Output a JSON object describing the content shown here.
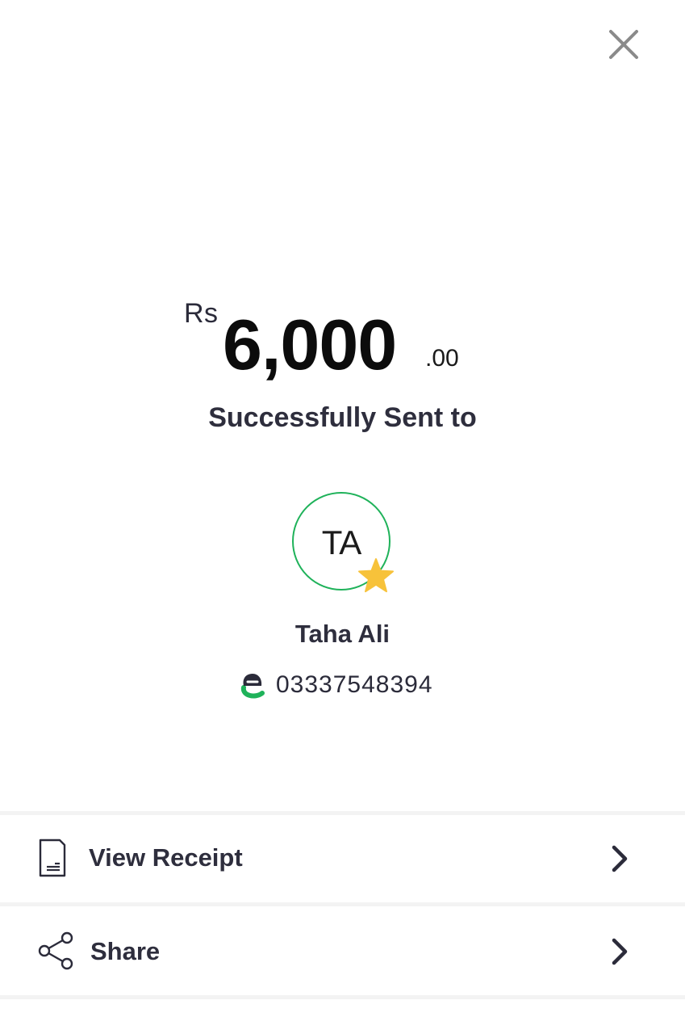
{
  "header": {
    "close_icon": "close-icon"
  },
  "transaction": {
    "currency": "Rs",
    "amount_main": "6,000",
    "amount_cents": ".00",
    "status": "Successfully Sent to"
  },
  "recipient": {
    "initials": "TA",
    "name": "Taha Ali",
    "wallet_icon": "wallet-logo-icon",
    "phone": "03337548394",
    "favorite_icon": "star-icon"
  },
  "actions": [
    {
      "label": "View Receipt",
      "icon": "receipt-icon"
    },
    {
      "label": "Share",
      "icon": "share-icon"
    }
  ],
  "colors": {
    "accent_green": "#1fb25a",
    "star_yellow": "#f7c23a",
    "text_dark": "#2e2e3d",
    "close_gray": "#8a8a8a"
  }
}
